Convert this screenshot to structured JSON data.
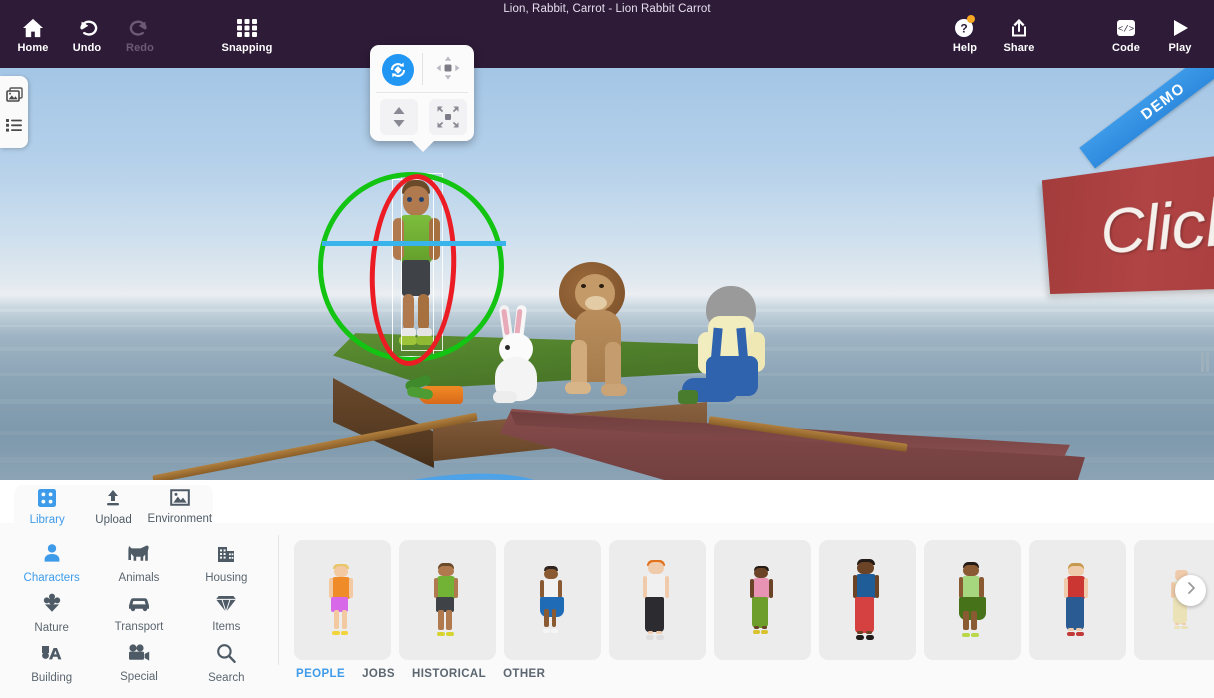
{
  "window": {
    "title": "Lion, Rabbit, Carrot - Lion Rabbit Carrot"
  },
  "toolbar": {
    "left_buttons": [
      {
        "label": "Home",
        "icon": "home-icon",
        "enabled": true
      },
      {
        "label": "Undo",
        "icon": "undo-icon",
        "enabled": true
      },
      {
        "label": "Redo",
        "icon": "redo-icon",
        "enabled": false
      },
      {
        "label": "Snapping",
        "icon": "grid-icon",
        "enabled": true
      }
    ],
    "right_buttons": [
      {
        "label": "Help",
        "icon": "help-icon",
        "badge": true
      },
      {
        "label": "Share",
        "icon": "share-icon",
        "badge": false
      },
      {
        "label": "Code",
        "icon": "code-icon",
        "badge": false
      },
      {
        "label": "Play",
        "icon": "play-icon",
        "badge": false
      }
    ],
    "badge_color": "#f5a623",
    "background_color": "#2e1b38"
  },
  "viewport": {
    "demo_ribbon": "DEMO",
    "billboard_text": "Click",
    "billboard_color": "#a83d3d",
    "ribbon_color": "#3c9ae8",
    "sky_color": "#a4c6e6",
    "water_color": "#8ba4b6",
    "selection": {
      "rotate_ring_y_color": "#13c413",
      "rotate_ring_x_color": "#ec1c24",
      "axis_color": "#39b4ea",
      "ground_ring_color": "#4da2e8",
      "selected_object": "boy-green-shirt"
    },
    "scene_objects": [
      "boy",
      "carrot",
      "rabbit",
      "lion",
      "rower",
      "rowboat",
      "grass-island"
    ]
  },
  "gizmo": {
    "buttons": [
      {
        "name": "rotate",
        "icon": "rotate-icon",
        "active": true
      },
      {
        "name": "move",
        "icon": "move-4way-icon",
        "active": false
      },
      {
        "name": "move-vertical",
        "icon": "up-down-icon",
        "active": false
      },
      {
        "name": "resize",
        "icon": "resize-icon",
        "active": false
      }
    ],
    "active_color": "#2196f3"
  },
  "left_panel": {
    "items": [
      {
        "icon": "scenes-icon"
      },
      {
        "icon": "list-icon"
      }
    ]
  },
  "library": {
    "tabs": [
      {
        "label": "Library",
        "icon": "library-icon",
        "active": true
      },
      {
        "label": "Upload",
        "icon": "upload-icon",
        "active": false
      },
      {
        "label": "Environment",
        "icon": "environment-icon",
        "active": false
      }
    ],
    "categories": [
      {
        "label": "Characters",
        "icon": "person-icon",
        "active": true
      },
      {
        "label": "Animals",
        "icon": "dog-icon",
        "active": false
      },
      {
        "label": "Housing",
        "icon": "building-icon",
        "active": false
      },
      {
        "label": "Nature",
        "icon": "flower-icon",
        "active": false
      },
      {
        "label": "Transport",
        "icon": "car-icon",
        "active": false
      },
      {
        "label": "Items",
        "icon": "gem-icon",
        "active": false
      },
      {
        "label": "Building",
        "icon": "text-block-icon",
        "active": false
      },
      {
        "label": "Special",
        "icon": "camera-icon",
        "active": false
      },
      {
        "label": "Search",
        "icon": "search-icon",
        "active": false
      }
    ],
    "subtabs": [
      {
        "label": "PEOPLE",
        "active": true
      },
      {
        "label": "JOBS",
        "active": false
      },
      {
        "label": "HISTORICAL",
        "active": false
      },
      {
        "label": "OTHER",
        "active": false
      }
    ],
    "thumbnails": [
      {
        "name": "kid-orange-shirt",
        "skin": "#f2c9a0",
        "hair": "#e8c766",
        "top": "#ef8b28",
        "bottom": "#d768e8",
        "shoes": "#f2d43a",
        "bottom_type": "shorts",
        "scale": 0.84
      },
      {
        "name": "boy-green-shirt",
        "skin": "#b07a4e",
        "hair": "#6b4a2a",
        "top": "#72b235",
        "bottom": "#3f4247",
        "shoes": "#d7d430",
        "bottom_type": "shorts",
        "scale": 0.86
      },
      {
        "name": "girl-blue-skirt",
        "skin": "#8a5a33",
        "hair": "#2d2420",
        "top": "#f2f2f2",
        "bottom": "#1f6bb5",
        "shoes": "#f5f5f5",
        "bottom_type": "skirt",
        "scale": 0.78
      },
      {
        "name": "man-white-shirt",
        "skin": "#f0cbab",
        "hair": "#e0711e",
        "top": "#f0f0f0",
        "bottom": "#2c2c30",
        "shoes": "#dddddd",
        "bottom_type": "pants",
        "scale": 0.94
      },
      {
        "name": "girl-pink-top",
        "skin": "#6b4326",
        "hair": "#241b17",
        "top": "#e893b4",
        "bottom": "#6d9e2c",
        "shoes": "#d8c32e",
        "bottom_type": "pants",
        "scale": 0.8
      },
      {
        "name": "man-blue-top",
        "skin": "#6b4326",
        "hair": "#241b17",
        "top": "#1f5d99",
        "bottom": "#d54141",
        "shoes": "#201c1a",
        "bottom_type": "pants",
        "scale": 0.95
      },
      {
        "name": "woman-green-top",
        "skin": "#8a5a33",
        "hair": "#241b17",
        "top": "#a6d67e",
        "bottom": "#46721a",
        "shoes": "#b8d84a",
        "bottom_type": "skirt",
        "scale": 0.88
      },
      {
        "name": "man-red-jacket",
        "skin": "#f0cbab",
        "hair": "#c59a4e",
        "top": "#cc3632",
        "bottom": "#2a5b93",
        "shoes": "#c23a3a",
        "bottom_type": "pants",
        "scale": 0.86
      },
      {
        "name": "baby",
        "skin": "#f0cbab",
        "hair": "#f0cbab",
        "top": "#ece2b8",
        "bottom": "#ece2b8",
        "shoes": "#ece2b8",
        "bottom_type": "pants",
        "scale": 0.7
      }
    ],
    "next_button_icon": "chevron-right-icon",
    "accent_color": "#3d9bea"
  }
}
